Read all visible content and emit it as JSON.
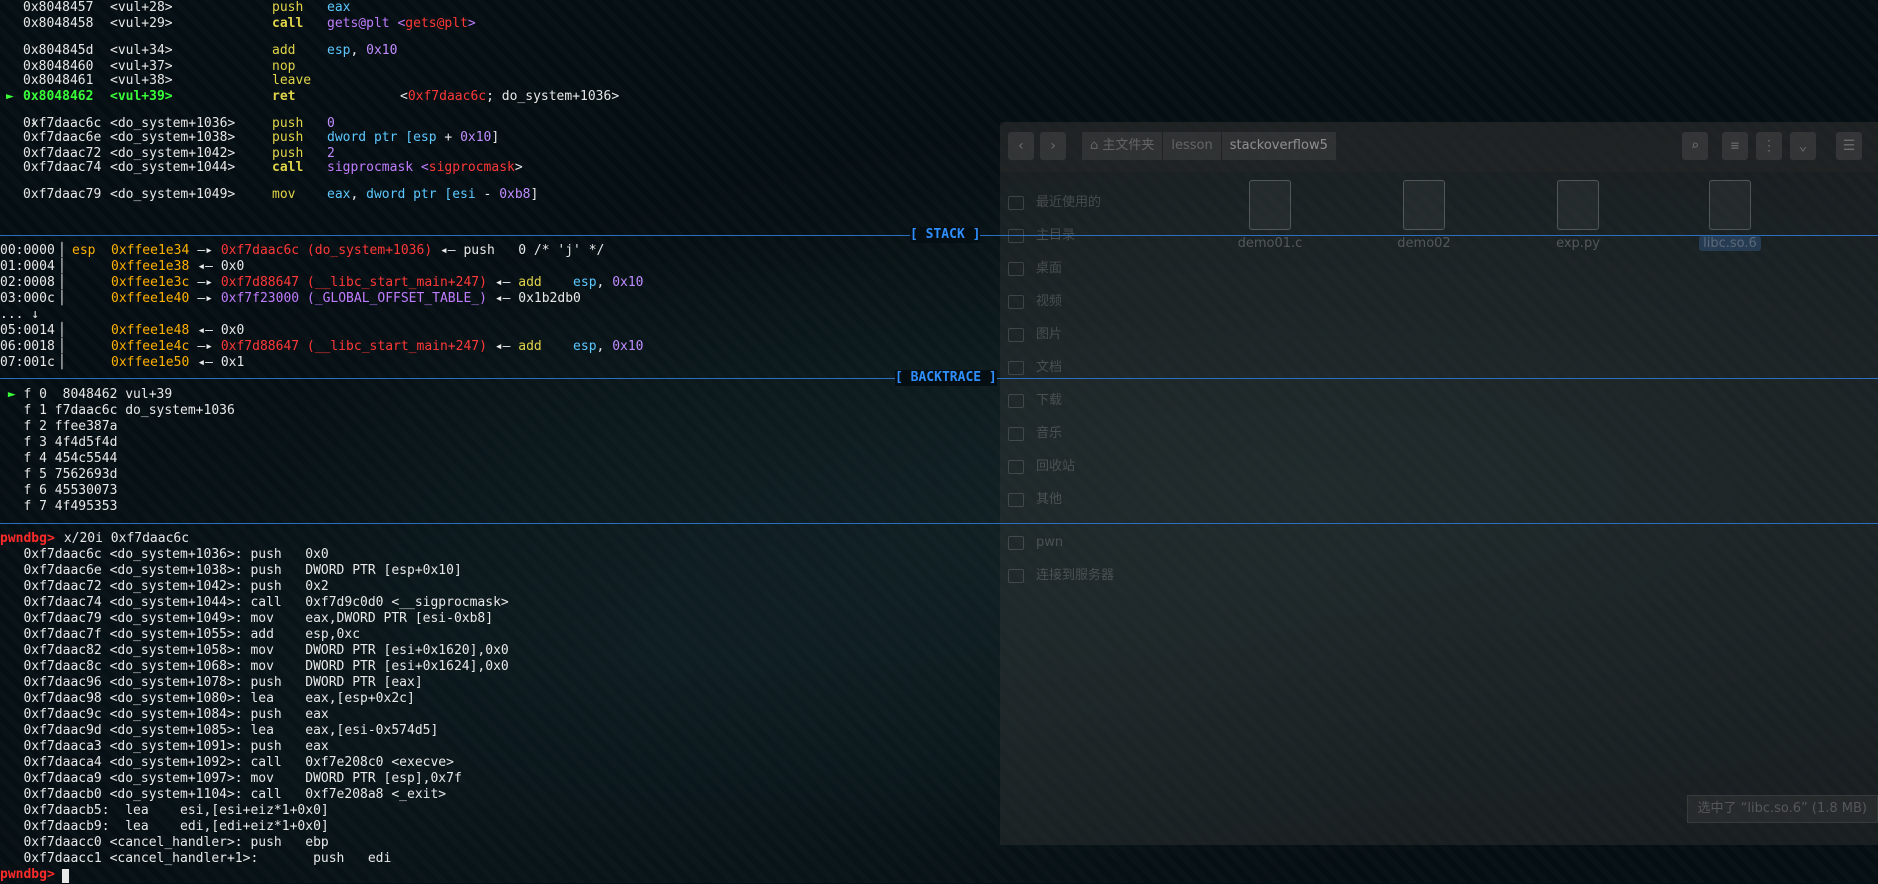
{
  "disasm": [
    {
      "addr": "0x8048457",
      "sym": "<vul+28>",
      "mn": "push",
      "ops": [
        {
          "t": "eax",
          "c": "reg"
        }
      ]
    },
    {
      "addr": "0x8048458",
      "sym": "<vul+29>",
      "mn": "call",
      "ops": [
        {
          "t": "gets@plt <",
          "c": "pur"
        },
        {
          "t": "gets@plt",
          "c": "red"
        },
        {
          "t": ">",
          "c": "pur"
        }
      ]
    },
    {
      "addr": "0x804845d",
      "sym": "<vul+34>",
      "mn": "add",
      "ops": [
        {
          "t": "esp",
          "c": "reg"
        },
        {
          "t": ", ",
          "c": "off"
        },
        {
          "t": "0x10",
          "c": "num"
        }
      ]
    },
    {
      "addr": "0x8048460",
      "sym": "<vul+37>",
      "mn": "nop",
      "ops": []
    },
    {
      "addr": "0x8048461",
      "sym": "<vul+38>",
      "mn": "leave",
      "ops": []
    },
    {
      "addr": "0x8048462",
      "sym": "<vul+39>",
      "mn": "ret",
      "ops": [
        {
          "t": "<",
          "c": "off"
        },
        {
          "t": "0xf7daac6c",
          "c": "red"
        },
        {
          "t": "; do_system+1036>",
          "c": "off"
        }
      ]
    },
    {
      "addr": "0xf7daac6c",
      "sym": "<do_system+1036>",
      "mn": "push",
      "ops": [
        {
          "t": "0",
          "c": "num"
        }
      ]
    },
    {
      "addr": "0xf7daac6e",
      "sym": "<do_system+1038>",
      "mn": "push",
      "ops": [
        {
          "t": "dword ptr [",
          "c": "reg"
        },
        {
          "t": "esp",
          "c": "reg"
        },
        {
          "t": " + ",
          "c": "off"
        },
        {
          "t": "0x10",
          "c": "num"
        },
        {
          "t": "]",
          "c": "off"
        }
      ]
    },
    {
      "addr": "0xf7daac72",
      "sym": "<do_system+1042>",
      "mn": "push",
      "ops": [
        {
          "t": "2",
          "c": "num"
        }
      ]
    },
    {
      "addr": "0xf7daac74",
      "sym": "<do_system+1044>",
      "mn": "call",
      "ops": [
        {
          "t": "sigprocmask <",
          "c": "pur"
        },
        {
          "t": "sigprocmask",
          "c": "red"
        },
        {
          "t": ">",
          "c": "off"
        }
      ]
    },
    {
      "addr": "0xf7daac79",
      "sym": "<do_system+1049>",
      "mn": "mov",
      "ops": [
        {
          "t": "eax",
          "c": "reg"
        },
        {
          "t": ", ",
          "c": "off"
        },
        {
          "t": "dword ptr [",
          "c": "reg"
        },
        {
          "t": "esi",
          "c": "reg"
        },
        {
          "t": " - ",
          "c": "off"
        },
        {
          "t": "0xb8",
          "c": "num"
        },
        {
          "t": "]",
          "c": "off"
        }
      ]
    }
  ],
  "pc_marker": "►",
  "down_arrow": "↓",
  "sections": {
    "stack": "[ STACK ]",
    "backtrace": "[ BACKTRACE ]"
  },
  "stack": [
    {
      "off": "00:0000",
      "reg": "esp",
      "addr": "0xffee1e34",
      "rest": [
        {
          "t": "—▸ ",
          "c": "off"
        },
        {
          "t": "0xf7daac6c (do_system+1036)",
          "c": "red"
        },
        {
          "t": " ◂— ",
          "c": "off"
        },
        {
          "t": "push   0 /* 'j' */",
          "c": "off"
        }
      ]
    },
    {
      "off": "01:0004",
      "reg": "",
      "addr": "0xffee1e38",
      "rest": [
        {
          "t": "◂— 0x0",
          "c": "off"
        }
      ]
    },
    {
      "off": "02:0008",
      "reg": "",
      "addr": "0xffee1e3c",
      "rest": [
        {
          "t": "—▸ ",
          "c": "off"
        },
        {
          "t": "0xf7d88647 (__libc_start_main+247)",
          "c": "red"
        },
        {
          "t": " ◂— ",
          "c": "off"
        },
        {
          "t": "add    ",
          "c": "mn"
        },
        {
          "t": "esp",
          "c": "reg"
        },
        {
          "t": ", ",
          "c": "off"
        },
        {
          "t": "0x10",
          "c": "num"
        }
      ]
    },
    {
      "off": "03:000c",
      "reg": "",
      "addr": "0xffee1e40",
      "rest": [
        {
          "t": "—▸ ",
          "c": "off"
        },
        {
          "t": "0xf7f23000 (_GLOBAL_OFFSET_TABLE_)",
          "c": "pur"
        },
        {
          "t": " ◂— 0x1b2db0",
          "c": "off"
        }
      ]
    },
    {
      "off": "... ↓",
      "reg": "",
      "addr": "",
      "rest": []
    },
    {
      "off": "05:0014",
      "reg": "",
      "addr": "0xffee1e48",
      "rest": [
        {
          "t": "◂— 0x0",
          "c": "off"
        }
      ]
    },
    {
      "off": "06:0018",
      "reg": "",
      "addr": "0xffee1e4c",
      "rest": [
        {
          "t": "—▸ ",
          "c": "off"
        },
        {
          "t": "0xf7d88647 (__libc_start_main+247)",
          "c": "red"
        },
        {
          "t": " ◂— ",
          "c": "off"
        },
        {
          "t": "add    ",
          "c": "mn"
        },
        {
          "t": "esp",
          "c": "reg"
        },
        {
          "t": ", ",
          "c": "off"
        },
        {
          "t": "0x10",
          "c": "num"
        }
      ]
    },
    {
      "off": "07:001c",
      "reg": "",
      "addr": "0xffee1e50",
      "rest": [
        {
          "t": "◂— 0x1",
          "c": "off"
        }
      ]
    }
  ],
  "backtrace": [
    " ► f 0  8048462 vul+39",
    "   f 1 f7daac6c do_system+1036",
    "   f 2 ffee387a",
    "   f 3 4f4d5f4d",
    "   f 4 454c5544",
    "   f 5 7562693d",
    "   f 6 45530073",
    "   f 7 4f495353"
  ],
  "prompt": "pwndbg>",
  "command": " x/20i 0xf7daac6c",
  "x20i": [
    "   0xf7daac6c <do_system+1036>: push   0x0",
    "   0xf7daac6e <do_system+1038>: push   DWORD PTR [esp+0x10]",
    "   0xf7daac72 <do_system+1042>: push   0x2",
    "   0xf7daac74 <do_system+1044>: call   0xf7d9c0d0 <__sigprocmask>",
    "   0xf7daac79 <do_system+1049>: mov    eax,DWORD PTR [esi-0xb8]",
    "   0xf7daac7f <do_system+1055>: add    esp,0xc",
    "   0xf7daac82 <do_system+1058>: mov    DWORD PTR [esi+0x1620],0x0",
    "   0xf7daac8c <do_system+1068>: mov    DWORD PTR [esi+0x1624],0x0",
    "   0xf7daac96 <do_system+1078>: push   DWORD PTR [eax]",
    "   0xf7daac98 <do_system+1080>: lea    eax,[esp+0x2c]",
    "   0xf7daac9c <do_system+1084>: push   eax",
    "   0xf7daac9d <do_system+1085>: lea    eax,[esi-0x574d5]",
    "   0xf7daaca3 <do_system+1091>: push   eax",
    "   0xf7daaca4 <do_system+1092>: call   0xf7e208c0 <execve>",
    "   0xf7daaca9 <do_system+1097>: mov    DWORD PTR [esp],0x7f",
    "   0xf7daacb0 <do_system+1104>: call   0xf7e208a8 <_exit>",
    "   0xf7daacb5:  lea    esi,[esi+eiz*1+0x0]",
    "   0xf7daacb9:  lea    edi,[edi+eiz*1+0x0]",
    "   0xf7daacc0 <cancel_handler>: push   ebp",
    "   0xf7daacc1 <cancel_handler+1>:       push   edi"
  ],
  "file_manager": {
    "path": [
      "主文件夹",
      "lesson",
      "stackoverflow5"
    ],
    "sidebar": [
      "最近使用的",
      "主目录",
      "桌面",
      "视频",
      "图片",
      "文档",
      "下载",
      "音乐",
      "回收站",
      "其他",
      "pwn",
      "连接到服务器"
    ],
    "files": [
      "demo01.c",
      "demo02",
      "exp.py",
      "libc.so.6"
    ],
    "status": "选中了 “libc.so.6” (1.8 MB)"
  },
  "colors": {
    "reg": "#5cc8ff",
    "mnemonic": "#e0d44a",
    "number": "#c08cff",
    "address_red": "#ff3838",
    "section": "#2f8fff",
    "prompt": "#ff2b2b"
  }
}
